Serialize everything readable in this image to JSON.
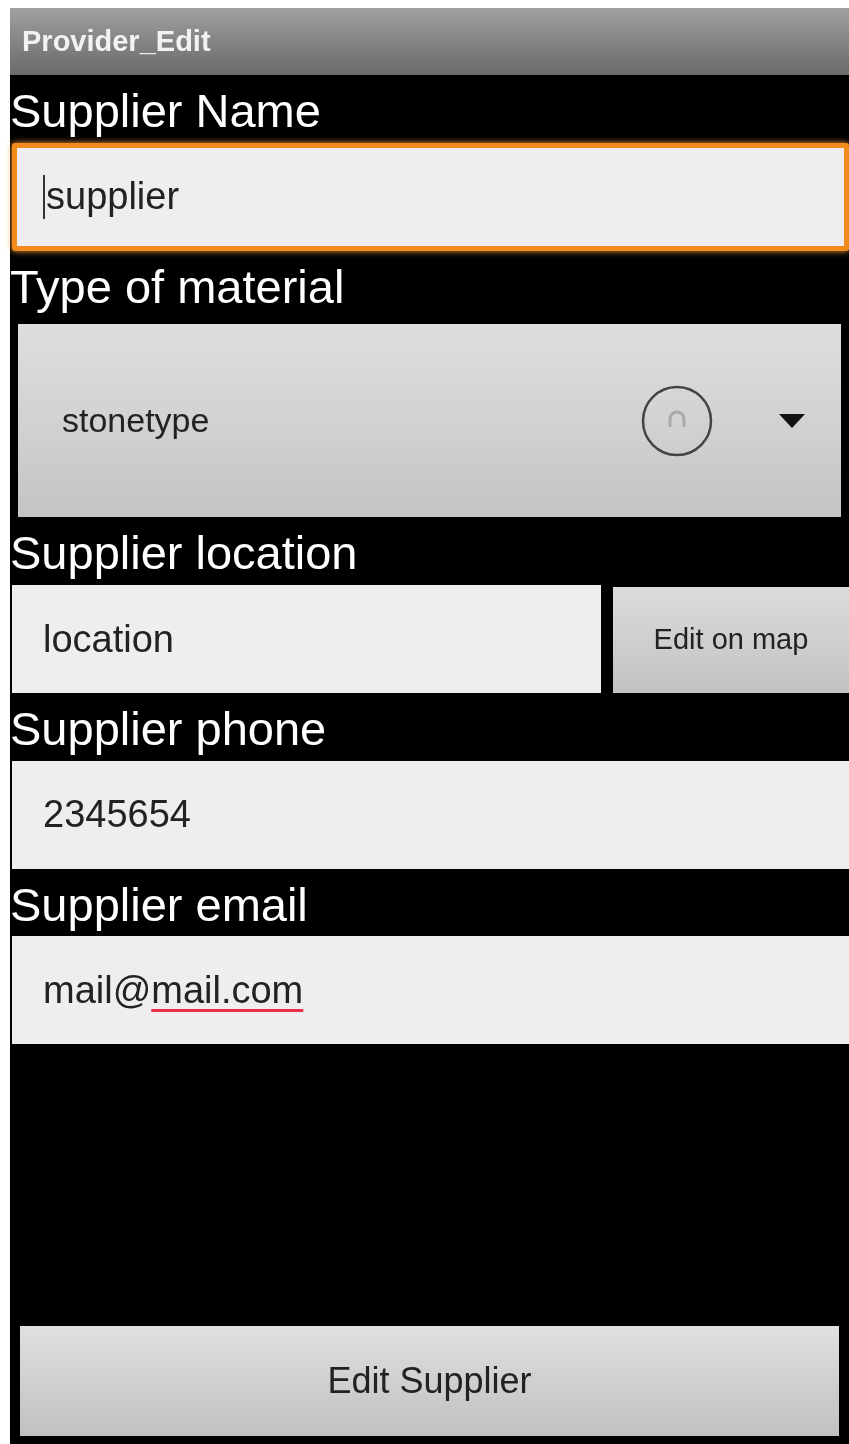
{
  "title_bar": {
    "title": "Provider_Edit"
  },
  "fields": [
    {
      "kind": "text",
      "label": "Supplier Name",
      "value": [
        {
          "text": "supplier",
          "misspelled": false
        }
      ],
      "focused": true
    },
    {
      "kind": "spinner",
      "label": "Type of material",
      "value": "stonetype"
    },
    {
      "kind": "text_with_button",
      "label": "Supplier location",
      "value": [
        {
          "text": "location",
          "misspelled": false
        }
      ],
      "focused": false,
      "button": "Edit on map"
    },
    {
      "kind": "text",
      "label": "Supplier phone",
      "value": [
        {
          "text": "2345654",
          "misspelled": false
        }
      ],
      "focused": false
    },
    {
      "kind": "text",
      "label": "Supplier email",
      "value": [
        {
          "text": "mail@",
          "misspelled": false
        },
        {
          "text": "mail.com",
          "misspelled": true
        }
      ],
      "focused": false
    }
  ],
  "submit_button": "Edit Supplier"
}
